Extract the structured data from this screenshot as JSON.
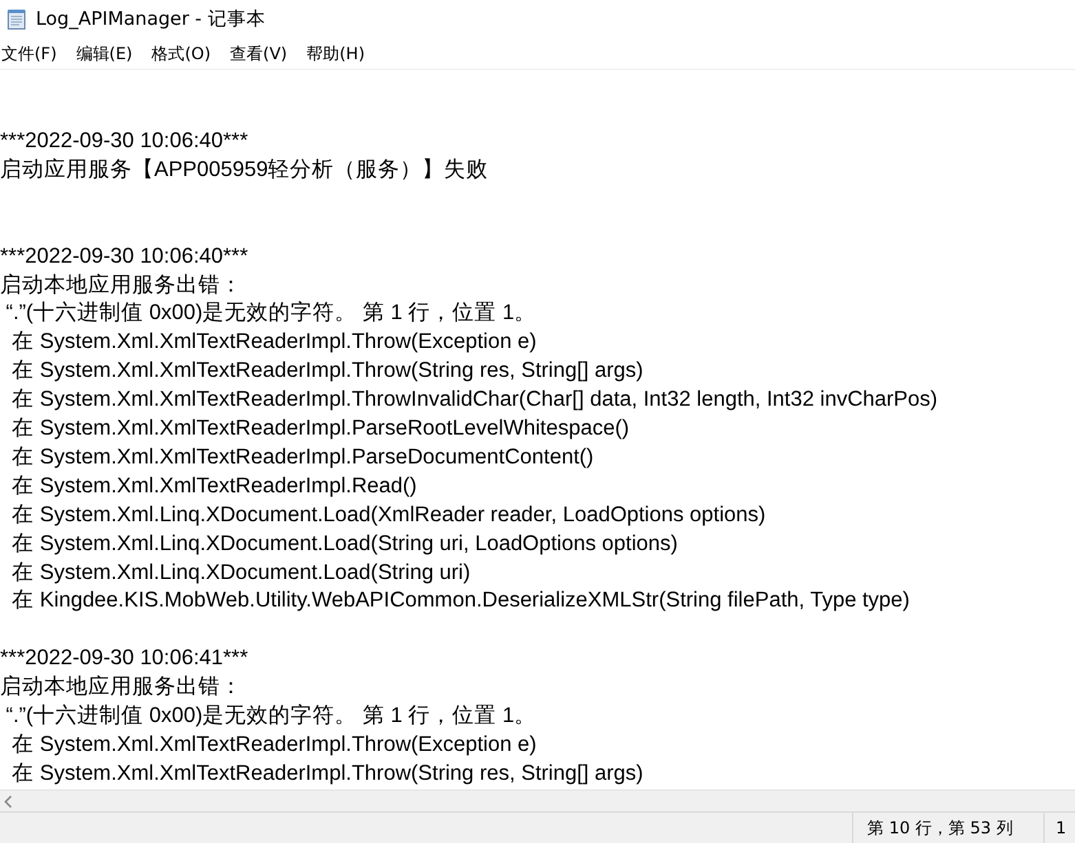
{
  "window": {
    "title": "Log_APIManager - 记事本"
  },
  "menu": [
    "文件(F)",
    "编辑(E)",
    "格式(O)",
    "查看(V)",
    "帮助(H)"
  ],
  "entries": [
    {
      "timestamp": "***2022-09-30 10:06:40***",
      "lines": [
        "启动应用服务【APP005959轻分析（服务）】失败"
      ]
    },
    {
      "timestamp": "***2022-09-30 10:06:40***",
      "lines": [
        "启动本地应用服务出错：",
        " “.”(十六进制值 0x00)是无效的字符。 第 1 行，位置 1。",
        "  在 System.Xml.XmlTextReaderImpl.Throw(Exception e)",
        "  在 System.Xml.XmlTextReaderImpl.Throw(String res, String[] args)",
        "  在 System.Xml.XmlTextReaderImpl.ThrowInvalidChar(Char[] data, Int32 length, Int32 invCharPos)",
        "  在 System.Xml.XmlTextReaderImpl.ParseRootLevelWhitespace()",
        "  在 System.Xml.XmlTextReaderImpl.ParseDocumentContent()",
        "  在 System.Xml.XmlTextReaderImpl.Read()",
        "  在 System.Xml.Linq.XDocument.Load(XmlReader reader, LoadOptions options)",
        "  在 System.Xml.Linq.XDocument.Load(String uri, LoadOptions options)",
        "  在 System.Xml.Linq.XDocument.Load(String uri)",
        "  在 Kingdee.KIS.MobWeb.Utility.WebAPICommon.DeserializeXMLStr(String filePath, Type type)"
      ]
    },
    {
      "timestamp": "***2022-09-30 10:06:41***",
      "lines": [
        "启动本地应用服务出错：",
        " “.”(十六进制值 0x00)是无效的字符。 第 1 行，位置 1。",
        "  在 System.Xml.XmlTextReaderImpl.Throw(Exception e)",
        "  在 System.Xml.XmlTextReaderImpl.Throw(String res, String[] args)"
      ]
    }
  ],
  "status_bar": {
    "position": "第 10 行，第 53 列",
    "zoom": "1"
  }
}
